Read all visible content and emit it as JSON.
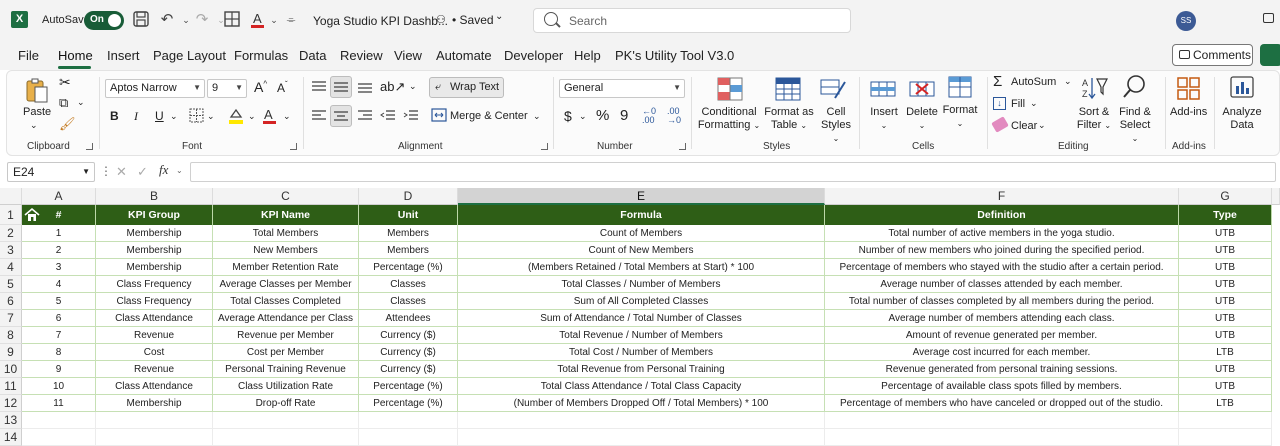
{
  "titlebar": {
    "app_icon": "X",
    "autosave_label": "AutoSave",
    "autosave_state": "On",
    "doc_title": "Yoga Studio KPI Dashb...",
    "doc_status": "• Saved",
    "search_placeholder": "Search",
    "avatar_initials": "SS",
    "accent": "#1d6f42"
  },
  "menu": {
    "items": [
      "File",
      "Home",
      "Insert",
      "Page Layout",
      "Formulas",
      "Data",
      "Review",
      "View",
      "Automate",
      "Developer",
      "Help",
      "PK's Utility Tool V3.0"
    ],
    "active": "Home",
    "comments_label": "Comments"
  },
  "ribbon": {
    "clipboard": {
      "paste_label": "Paste",
      "group_label": "Clipboard"
    },
    "font": {
      "font_name": "Aptos Narrow",
      "font_size": "9",
      "bold": "B",
      "italic": "I",
      "underline": "U",
      "group_label": "Font"
    },
    "alignment": {
      "wrap_text": "Wrap Text",
      "merge_center": "Merge & Center",
      "group_label": "Alignment"
    },
    "number": {
      "format": "General",
      "currency": "$",
      "percent": "%",
      "comma": "9",
      "group_label": "Number"
    },
    "styles": {
      "conditional_formatting": [
        "Conditional",
        "Formatting"
      ],
      "format_as_table": [
        "Format as",
        "Table"
      ],
      "cell_styles": [
        "Cell",
        "Styles"
      ],
      "group_label": "Styles"
    },
    "cells": {
      "insert": "Insert",
      "delete": "Delete",
      "format": "Format",
      "group_label": "Cells"
    },
    "editing": {
      "autosum": "AutoSum",
      "fill": "Fill",
      "clear": "Clear",
      "sort_filter": [
        "Sort &",
        "Filter"
      ],
      "find_select": [
        "Find &",
        "Select"
      ],
      "group_label": "Editing"
    },
    "addins": {
      "addins": "Add-ins",
      "group_label": "Add-ins"
    },
    "analyze": {
      "analyze": [
        "Analyze",
        "Data"
      ]
    }
  },
  "formula_bar": {
    "name_box": "E24",
    "fx": "fx",
    "formula": ""
  },
  "sheet": {
    "column_letters": [
      "A",
      "B",
      "C",
      "D",
      "E",
      "F",
      "G"
    ],
    "selected_column": "E",
    "row_numbers": [
      "1",
      "2",
      "3",
      "4",
      "5",
      "6",
      "7",
      "8",
      "9",
      "10",
      "11",
      "12",
      "13",
      "14"
    ],
    "header_fill": "#2e5e16",
    "headers": [
      "#",
      "KPI Group",
      "KPI Name",
      "Unit",
      "Formula",
      "Definition",
      "Type"
    ],
    "rows": [
      [
        "1",
        "Membership",
        "Total Members",
        "Members",
        "Count of Members",
        "Total number of active members in the yoga studio.",
        "UTB"
      ],
      [
        "2",
        "Membership",
        "New Members",
        "Members",
        "Count of New Members",
        "Number of new members who joined during the specified period.",
        "UTB"
      ],
      [
        "3",
        "Membership",
        "Member Retention Rate",
        "Percentage (%)",
        "(Members Retained / Total Members at Start) * 100",
        "Percentage of members who stayed with the studio after a certain period.",
        "UTB"
      ],
      [
        "4",
        "Class Frequency",
        "Average Classes per Member",
        "Classes",
        "Total Classes / Number of Members",
        "Average number of classes attended by each member.",
        "UTB"
      ],
      [
        "5",
        "Class Frequency",
        "Total Classes Completed",
        "Classes",
        "Sum of All Completed Classes",
        "Total number of classes completed by all members during the period.",
        "UTB"
      ],
      [
        "6",
        "Class Attendance",
        "Average Attendance per Class",
        "Attendees",
        "Sum of Attendance / Total Number of Classes",
        "Average number of members attending each class.",
        "UTB"
      ],
      [
        "7",
        "Revenue",
        "Revenue per Member",
        "Currency ($)",
        "Total Revenue / Number of Members",
        "Amount of revenue generated per member.",
        "UTB"
      ],
      [
        "8",
        "Cost",
        "Cost per Member",
        "Currency ($)",
        "Total Cost / Number of Members",
        "Average cost incurred for each member.",
        "LTB"
      ],
      [
        "9",
        "Revenue",
        "Personal Training Revenue",
        "Currency ($)",
        "Total Revenue from Personal Training",
        "Revenue generated from personal training sessions.",
        "UTB"
      ],
      [
        "10",
        "Class Attendance",
        "Class Utilization Rate",
        "Percentage (%)",
        "Total Class Attendance / Total Class Capacity",
        "Percentage of available class spots filled by members.",
        "UTB"
      ],
      [
        "11",
        "Membership",
        "Drop-off Rate",
        "Percentage (%)",
        "(Number of Members Dropped Off / Total Members) * 100",
        "Percentage of members who have canceled or dropped out of the studio.",
        "LTB"
      ]
    ]
  }
}
